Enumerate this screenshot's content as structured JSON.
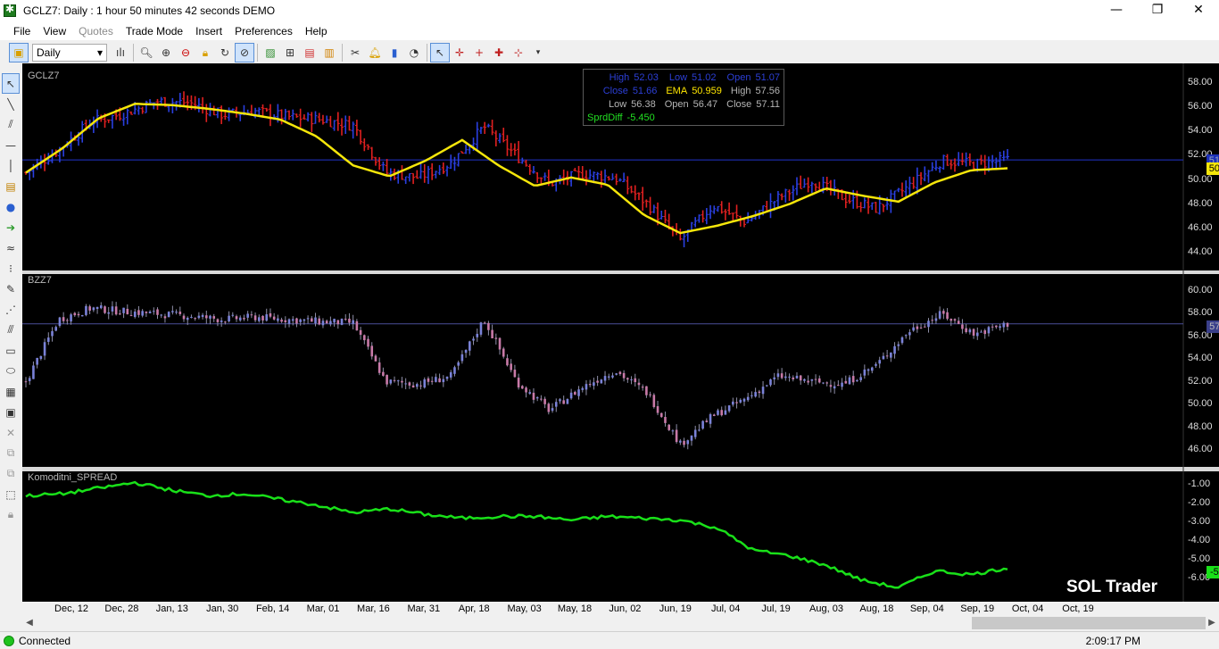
{
  "window": {
    "title": "GCLZ7: Daily : 1 hour 50 minutes 42 seconds DEMO",
    "controls": [
      "—",
      "❐",
      "✕"
    ]
  },
  "menu": [
    "File",
    "View",
    "Quotes",
    "Trade Mode",
    "Insert",
    "Preferences",
    "Help"
  ],
  "toolbar": {
    "period": "Daily"
  },
  "info_box": {
    "row1": {
      "high_label": "High",
      "high": "52.03",
      "low_label": "Low",
      "low": "51.02",
      "open_label": "Open",
      "open": "51.07"
    },
    "row2": {
      "close_label": "Close",
      "close": "51.66",
      "ema_label": "EMA",
      "ema": "50.959",
      "high_label": "High",
      "high": "57.56"
    },
    "row3": {
      "low_label": "Low",
      "low": "56.38",
      "open_label": "Open",
      "open": "56.47",
      "close_label": "Close",
      "close": "57.11"
    },
    "row4": {
      "label": "SprdDiff",
      "value": "-5.450"
    }
  },
  "panes": {
    "top": {
      "label": "GCLZ7",
      "last_price": "51.66",
      "ema_price": "50.96"
    },
    "middle": {
      "label": "BZZ7",
      "last_price": "57.11"
    },
    "bottom": {
      "label": "Komoditni_SPREAD",
      "last_value": "-5.45"
    }
  },
  "brand": "SOL Trader",
  "status": {
    "connection": "Connected",
    "time": "2:09:17 PM"
  },
  "colors": {
    "up": "#2a3fe0",
    "down": "#e02020",
    "ema": "#f5e60a",
    "spread": "#19e019",
    "lastline": "#2233cc"
  },
  "chart_data": [
    {
      "type": "ohlc",
      "label": "GCLZ7",
      "ylim": [
        42.5,
        59.5
      ],
      "ticks": [
        44,
        46,
        48,
        50,
        52,
        54,
        56,
        58
      ],
      "tick_labels": [
        "44.00",
        "46.00",
        "48.00",
        "50.00",
        "52.00",
        "54.00",
        "56.00",
        "58.00"
      ],
      "x_labels": [
        "Dec, 12",
        "Dec, 28",
        "Jan, 13",
        "Jan, 30",
        "Feb, 14",
        "Mar, 01",
        "Mar, 16",
        "Mar, 31",
        "Apr, 18",
        "May, 03",
        "May, 18",
        "Jun, 02",
        "Jun, 19",
        "Jul, 04",
        "Jul, 19",
        "Aug, 03",
        "Aug, 18",
        "Sep, 04",
        "Sep, 19",
        "Oct, 04",
        "Oct, 19"
      ],
      "close_anchors": [
        50.6,
        52.5,
        54.8,
        55.5,
        56.5,
        56.4,
        55.4,
        55.7,
        55.2,
        55.0,
        54.5,
        50.6,
        50.2,
        51.4,
        54.4,
        52.0,
        49.7,
        50.5,
        50.2,
        48.0,
        45.0,
        47.9,
        46.5,
        48.5,
        50.0,
        48.5,
        47.6,
        49.5,
        51.6,
        51.3,
        51.66
      ],
      "ema_anchors": [
        50.6,
        52.6,
        55.1,
        56.3,
        56.2,
        55.9,
        55.5,
        55.0,
        53.6,
        51.2,
        50.3,
        51.6,
        53.3,
        51.2,
        49.5,
        50.2,
        49.6,
        47.1,
        45.6,
        46.2,
        47.0,
        48.0,
        49.3,
        48.7,
        48.2,
        49.8,
        50.8,
        50.96
      ],
      "last": 51.66
    },
    {
      "type": "candlestick",
      "label": "BZZ7",
      "ylim": [
        44.5,
        61.5
      ],
      "ticks": [
        46,
        48,
        50,
        52,
        54,
        56,
        58,
        60
      ],
      "tick_labels": [
        "46.00",
        "48.00",
        "50.00",
        "52.00",
        "54.00",
        "56.00",
        "58.00",
        "60.00"
      ],
      "close_anchors": [
        52.0,
        57.5,
        58.5,
        58.2,
        58.0,
        57.8,
        57.5,
        57.7,
        57.5,
        57.3,
        57.2,
        52.0,
        51.8,
        52.5,
        57.5,
        52.0,
        49.5,
        51.5,
        53.0,
        51.0,
        46.5,
        49.0,
        50.5,
        52.5,
        52.0,
        51.8,
        53.5,
        56.5,
        58.0,
        56.2,
        57.11
      ],
      "last": 57.11
    },
    {
      "type": "line",
      "label": "Komoditni_SPREAD",
      "ylim": [
        -7.2,
        -0.3
      ],
      "ticks": [
        -1,
        -2,
        -3,
        -4,
        -5,
        -6
      ],
      "tick_labels": [
        "-1.00",
        "-2.00",
        "-3.00",
        "-4.00",
        "-5.00",
        "-6.00"
      ],
      "anchors": [
        -1.6,
        -1.5,
        -1.2,
        -0.9,
        -1.3,
        -1.6,
        -1.5,
        -1.8,
        -2.1,
        -2.5,
        -2.3,
        -2.6,
        -2.8,
        -2.7,
        -2.7,
        -2.9,
        -2.7,
        -2.8,
        -2.9,
        -3.3,
        -4.5,
        -4.8,
        -5.3,
        -6.1,
        -6.5,
        -5.6,
        -5.8,
        -5.45
      ],
      "last": -5.45
    }
  ]
}
